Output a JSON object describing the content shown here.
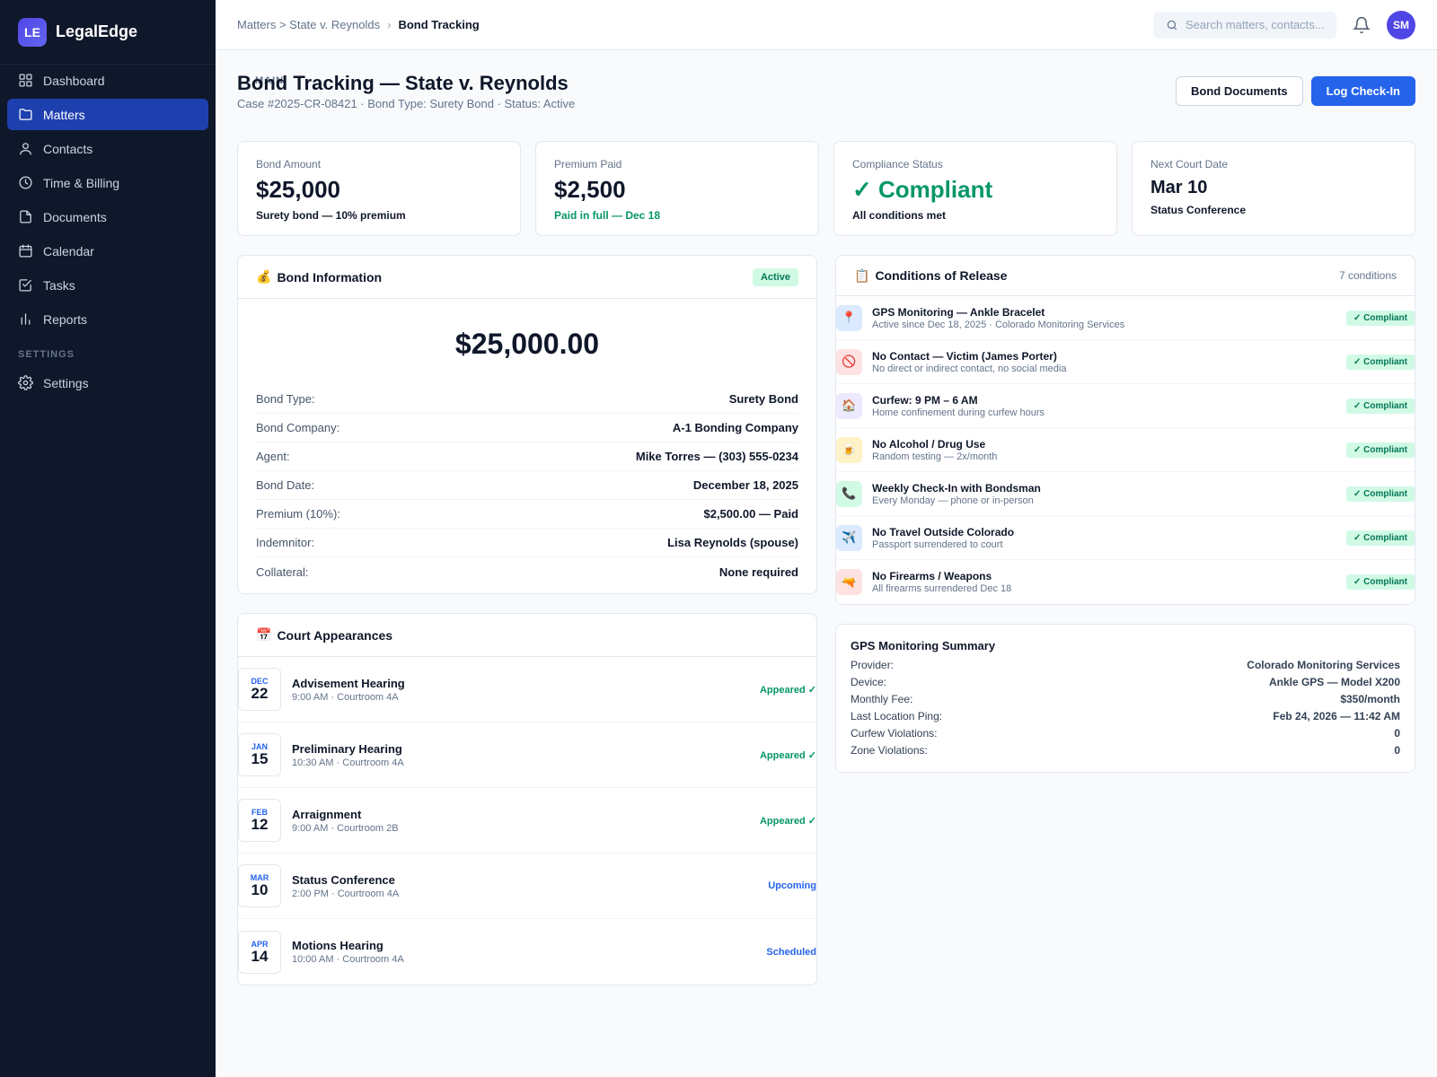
{
  "app": {
    "logo": "LE",
    "name": "LegalEdge"
  },
  "sidebar": {
    "main_label": "MAIN",
    "settings_label": "SETTINGS",
    "items": [
      {
        "label": "Dashboard",
        "icon": "grid-icon"
      },
      {
        "label": "Matters",
        "icon": "folder-icon"
      },
      {
        "label": "Contacts",
        "icon": "person-icon"
      },
      {
        "label": "Time & Billing",
        "icon": "clock-icon"
      },
      {
        "label": "Documents",
        "icon": "document-icon"
      },
      {
        "label": "Calendar",
        "icon": "calendar-icon"
      },
      {
        "label": "Tasks",
        "icon": "checkbox-icon"
      },
      {
        "label": "Reports",
        "icon": "bar-chart-icon"
      }
    ],
    "settings_item": {
      "label": "Settings",
      "icon": "gear-icon"
    },
    "active": "Matters"
  },
  "topbar": {
    "breadcrumb": {
      "parent": "Matters > State v. Reynolds",
      "separator": "›",
      "current": "Bond Tracking"
    },
    "search_placeholder": "Search matters, contacts...",
    "avatar": "SM"
  },
  "page": {
    "title": "Bond Tracking — State v. Reynolds",
    "subtitle": "Case #2025-CR-08421 · Bond Type: Surety Bond · Status: Active",
    "actions": {
      "documents": "Bond Documents",
      "checkin": "Log Check-In"
    }
  },
  "stats": [
    {
      "label": "Bond Amount",
      "value": "$25,000",
      "note": "Surety bond — 10% premium"
    },
    {
      "label": "Premium Paid",
      "value": "$2,500",
      "note": "Paid in full — Dec 18"
    },
    {
      "label": "Compliance Status",
      "value": "✓ Compliant",
      "note": "All conditions met"
    },
    {
      "label": "Next Court Date",
      "value": "Mar 10",
      "note": "Status Conference"
    }
  ],
  "bond_info": {
    "icon": "💰",
    "title": "Bond Information",
    "badge": "Active",
    "amount": "$25,000.00",
    "rows": [
      {
        "k": "Bond Type:",
        "v": "Surety Bond"
      },
      {
        "k": "Bond Company:",
        "v": "A-1 Bonding Company"
      },
      {
        "k": "Agent:",
        "v": "Mike Torres — (303) 555-0234"
      },
      {
        "k": "Bond Date:",
        "v": "December 18, 2025"
      },
      {
        "k": "Premium (10%):",
        "v": "$2,500.00 — Paid"
      },
      {
        "k": "Indemnitor:",
        "v": "Lisa Reynolds (spouse)"
      },
      {
        "k": "Collateral:",
        "v": "None required"
      }
    ]
  },
  "court": {
    "icon": "📅",
    "title": "Court Appearances",
    "items": [
      {
        "month": "DEC",
        "day": "22",
        "title": "Advisement Hearing",
        "sub": "9:00 AM · Courtroom 4A",
        "status": "Appeared ✓",
        "kind": "appeared"
      },
      {
        "month": "JAN",
        "day": "15",
        "title": "Preliminary Hearing",
        "sub": "10:30 AM · Courtroom 4A",
        "status": "Appeared ✓",
        "kind": "appeared"
      },
      {
        "month": "FEB",
        "day": "12",
        "title": "Arraignment",
        "sub": "9:00 AM · Courtroom 2B",
        "status": "Appeared ✓",
        "kind": "appeared"
      },
      {
        "month": "MAR",
        "day": "10",
        "title": "Status Conference",
        "sub": "2:00 PM · Courtroom 4A",
        "status": "Upcoming",
        "kind": "future"
      },
      {
        "month": "APR",
        "day": "14",
        "title": "Motions Hearing",
        "sub": "10:00 AM · Courtroom 4A",
        "status": "Scheduled",
        "kind": "future"
      }
    ]
  },
  "conditions": {
    "icon": "📋",
    "title": "Conditions of Release",
    "count": "7 conditions",
    "items": [
      {
        "icon": "📍",
        "bg": "#dbeafe",
        "title": "GPS Monitoring — Ankle Bracelet",
        "sub": "Active since Dec 18, 2025 · Colorado Monitoring Services",
        "status": "✓ Compliant"
      },
      {
        "icon": "🚫",
        "bg": "#fee2e2",
        "title": "No Contact — Victim (James Porter)",
        "sub": "No direct or indirect contact, no social media",
        "status": "✓ Compliant"
      },
      {
        "icon": "🏠",
        "bg": "#ede9fe",
        "title": "Curfew: 9 PM – 6 AM",
        "sub": "Home confinement during curfew hours",
        "status": "✓ Compliant"
      },
      {
        "icon": "🍺",
        "bg": "#fef3c7",
        "title": "No Alcohol / Drug Use",
        "sub": "Random testing — 2x/month",
        "status": "✓ Compliant"
      },
      {
        "icon": "📞",
        "bg": "#d1fae5",
        "title": "Weekly Check-In with Bondsman",
        "sub": "Every Monday — phone or in-person",
        "status": "✓ Compliant"
      },
      {
        "icon": "✈️",
        "bg": "#dbeafe",
        "title": "No Travel Outside Colorado",
        "sub": "Passport surrendered to court",
        "status": "✓ Compliant"
      },
      {
        "icon": "🔫",
        "bg": "#fee2e2",
        "title": "No Firearms / Weapons",
        "sub": "All firearms surrendered Dec 18",
        "status": "✓ Compliant"
      }
    ]
  },
  "gps": {
    "title": "GPS Monitoring Summary",
    "rows": [
      {
        "k": "Provider:",
        "v": "Colorado Monitoring Services"
      },
      {
        "k": "Device:",
        "v": "Ankle GPS — Model X200"
      },
      {
        "k": "Monthly Fee:",
        "v": "$350/month"
      },
      {
        "k": "Last Location Ping:",
        "v": "Feb 24, 2026 — 11:42 AM"
      },
      {
        "k": "Curfew Violations:",
        "v": "0"
      },
      {
        "k": "Zone Violations:",
        "v": "0"
      }
    ]
  },
  "colors": {
    "sidebar_bg": "#0f172a",
    "active_nav": "#1e40af",
    "primary": "#2563eb",
    "success": "#059669",
    "brand": "#4f46e5"
  }
}
